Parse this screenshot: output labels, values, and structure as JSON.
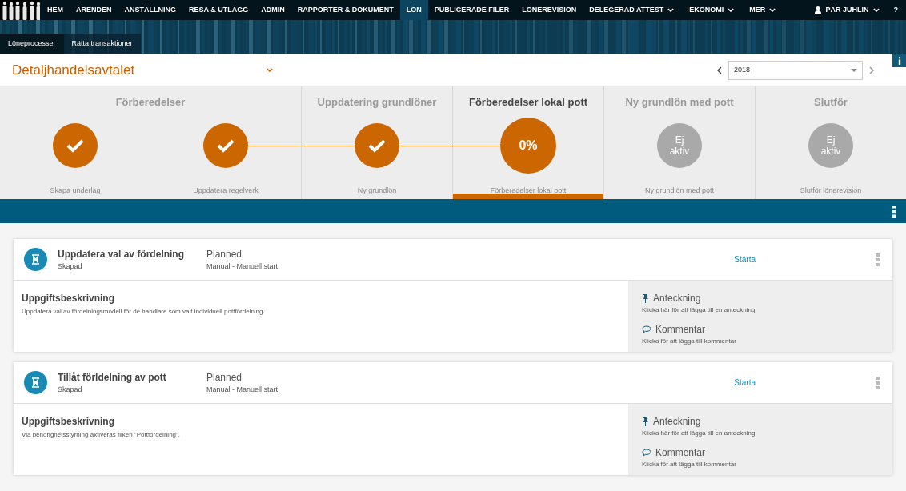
{
  "nav": {
    "items": [
      {
        "label": "HEM",
        "selected": false,
        "dropdown": false
      },
      {
        "label": "ÄRENDEN",
        "selected": false,
        "dropdown": false
      },
      {
        "label": "ANSTÄLLNING",
        "selected": false,
        "dropdown": false
      },
      {
        "label": "RESA & UTLÄGG",
        "selected": false,
        "dropdown": false
      },
      {
        "label": "ADMIN",
        "selected": false,
        "dropdown": false
      },
      {
        "label": "RAPPORTER & DOKUMENT",
        "selected": false,
        "dropdown": false
      },
      {
        "label": "LÖN",
        "selected": true,
        "dropdown": false
      },
      {
        "label": "PUBLICERADE FILER",
        "selected": false,
        "dropdown": false
      },
      {
        "label": "LÖNEREVISION",
        "selected": false,
        "dropdown": false
      },
      {
        "label": "DELEGERAD ATTEST",
        "selected": false,
        "dropdown": true
      },
      {
        "label": "EKONOMI",
        "selected": false,
        "dropdown": true
      },
      {
        "label": "MER",
        "selected": false,
        "dropdown": true
      }
    ],
    "user": "PÄR JUHLIN",
    "help": "?"
  },
  "subtabs": [
    {
      "label": "Löneprocesser",
      "selected": true
    },
    {
      "label": "Rätta transaktioner",
      "selected": false
    }
  ],
  "header": {
    "title": "Detaljhandelsavtalet",
    "year": "2018"
  },
  "phases": [
    {
      "title": "Förberedelser",
      "selected": false,
      "steps": [
        {
          "label": "Skapa underlag",
          "kind": "done",
          "linked": false
        },
        {
          "label": "Uppdatera regelverk",
          "kind": "done",
          "linked": false
        }
      ]
    },
    {
      "title": "Uppdatering grundlöner",
      "selected": false,
      "steps": [
        {
          "label": "Ny grundlön",
          "kind": "done",
          "linked": true
        }
      ]
    },
    {
      "title": "Förberedelser lokal pott",
      "selected": true,
      "steps": [
        {
          "label": "Förberedelser lokal pott",
          "kind": "active",
          "linked": true,
          "text": "0%"
        }
      ]
    },
    {
      "title": "Ny grundlön med pott",
      "selected": false,
      "steps": [
        {
          "label": "Ny grundlön med pott",
          "kind": "inactive",
          "linked": false,
          "text": "Ej aktiv"
        }
      ]
    },
    {
      "title": "Slutför",
      "selected": false,
      "steps": [
        {
          "label": "Slutför lönerevision",
          "kind": "inactive",
          "linked": false,
          "text": "Ej aktiv"
        }
      ]
    }
  ],
  "tasks": [
    {
      "title": "Uppdatera val av fördelning",
      "state": "Skapad",
      "status": "Planned",
      "start_mode": "Manual - Manuell start",
      "action": "Starta",
      "description_title": "Uppgiftsbeskrivning",
      "description": "Uppdatera val av fördelningsmodell för de handlare som valt individuell pottfördelning.",
      "note_title": "Anteckning",
      "note_hint": "Klicka här för att lägga till en anteckning",
      "comment_title": "Kommentar",
      "comment_hint": "Klicka för att lägga till kommentar"
    },
    {
      "title": "Tillåt förldelning av pott",
      "state": "Skapad",
      "status": "Planned",
      "start_mode": "Manual - Manuell start",
      "action": "Starta",
      "description_title": "Uppgiftsbeskrivning",
      "description": "Via behörighetsstyrning aktiveras fliken \"Pottfördelning\".",
      "note_title": "Anteckning",
      "note_hint": "Klicka här för att lägga till en anteckning",
      "comment_title": "Kommentar",
      "comment_hint": "Klicka för att lägga till kommentar"
    }
  ]
}
